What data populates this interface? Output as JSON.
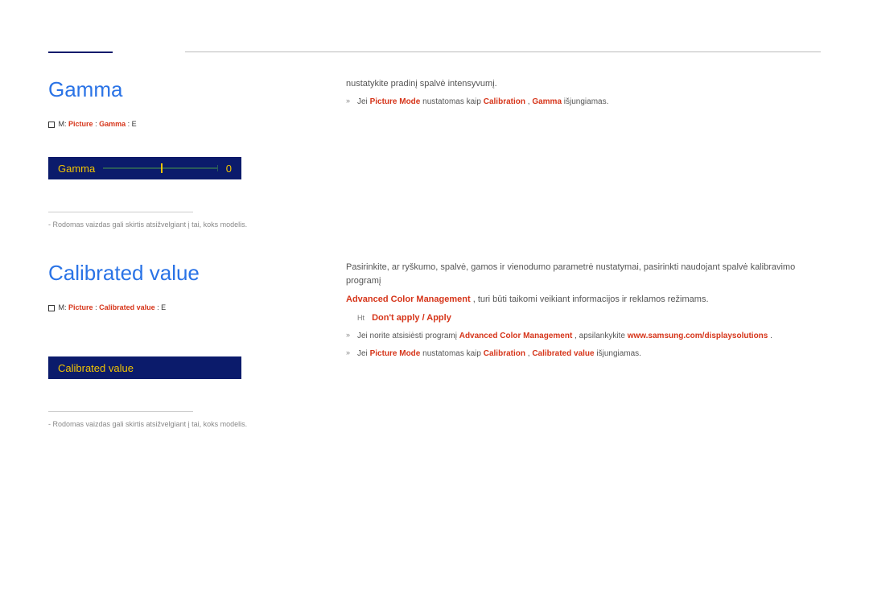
{
  "gamma": {
    "title": "Gamma",
    "breadcrumb_prefix": "M:",
    "breadcrumb_p1": "Picture",
    "breadcrumb_sep": ":",
    "breadcrumb_p2": "Gamma",
    "breadcrumb_tail": ": E",
    "bar_label": "Gamma",
    "bar_value": "0",
    "note": "Rodomas vaizdas gali skirtis atsižvelgiant į tai, koks modelis.",
    "desc": "nustatykite pradinį spalvė intensyvumį.",
    "bullet1_pre": "Jei ",
    "bullet1_b1": "Picture Mode",
    "bullet1_mid": " nustatomas kaip ",
    "bullet1_b2": "Calibration",
    "bullet1_sep": ", ",
    "bullet1_b3": "Gamma",
    "bullet1_tail": " išjungiamas."
  },
  "calibrated": {
    "title": "Calibrated value",
    "breadcrumb_prefix": "M:",
    "breadcrumb_p1": "Picture",
    "breadcrumb_sep": ":",
    "breadcrumb_p2": "Calibrated value",
    "breadcrumb_tail": ": E",
    "bar_label": "Calibrated value",
    "note": "Rodomas vaizdas gali skirtis atsižvelgiant į tai, koks modelis.",
    "desc1": "Pasirinkite, ar ryškumo, spalvė, gamos ir vienodumo parametrė nustatymai, pasirinkti naudojant spalvė kalibravimo programį",
    "desc2_b": "Advanced Color Management",
    "desc2_t": ", turi būti taikomi veikiant informacijos ir reklamos režimams.",
    "opt_kbd": "Ht",
    "opt_text": "Don't apply / Apply",
    "bullet1_pre": "Jei norite atsisiėsti programį ",
    "bullet1_b1": "Advanced Color Management",
    "bullet1_mid": ", apsilankykite ",
    "bullet1_b2": "www.samsung.com/displaysolutions",
    "bullet1_tail": ".",
    "bullet2_pre": "Jei ",
    "bullet2_b1": "Picture Mode",
    "bullet2_mid": " nustatomas kaip ",
    "bullet2_b2": "Calibration",
    "bullet2_sep": ", ",
    "bullet2_b3": "Calibrated value",
    "bullet2_tail": " išjungiamas."
  }
}
